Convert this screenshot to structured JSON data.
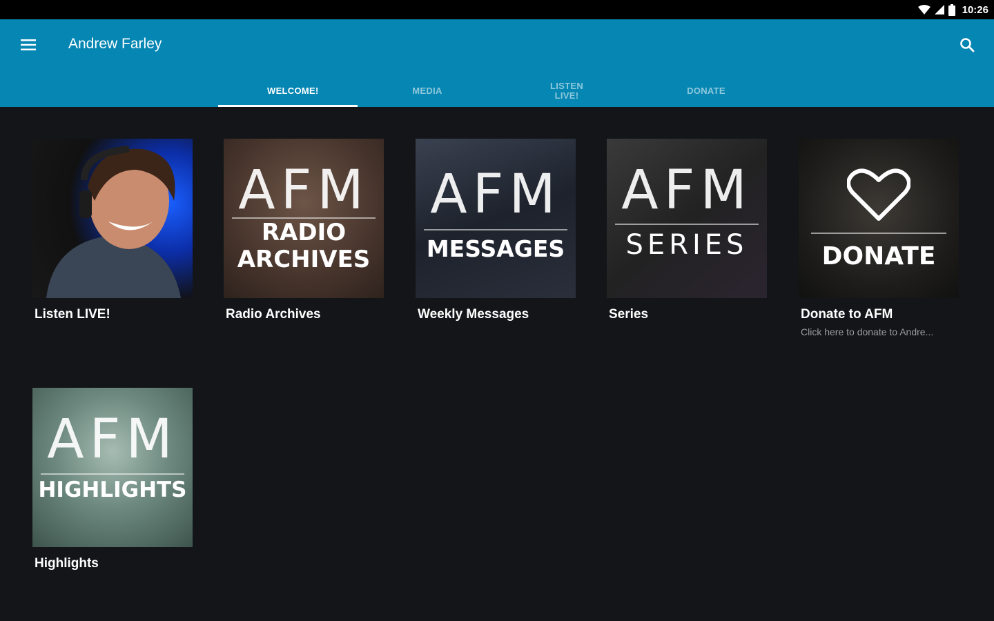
{
  "status_bar": {
    "time": "10:26"
  },
  "app_bar": {
    "title": "Andrew Farley"
  },
  "tabs": [
    {
      "label": "WELCOME!",
      "active": true
    },
    {
      "label": "MEDIA",
      "active": false
    },
    {
      "label": "LISTEN\nLIVE!",
      "active": false
    },
    {
      "label": "DONATE",
      "active": false
    }
  ],
  "tiles": [
    {
      "title": "Listen LIVE!",
      "art": {
        "text": ""
      }
    },
    {
      "title": "Radio Archives",
      "art": {
        "brand": "AFM",
        "line1": "RADIO",
        "line2": "ARCHIVES"
      }
    },
    {
      "title": "Weekly Messages",
      "art": {
        "brand": "AFM",
        "line1": "MESSAGES"
      }
    },
    {
      "title": "Series",
      "art": {
        "brand": "AFM",
        "line1": "SERIES"
      }
    },
    {
      "title": "Donate to AFM",
      "subtitle": "Click here to donate to Andre...",
      "art": {
        "line1": "DONATE"
      }
    },
    {
      "title": "Highlights",
      "art": {
        "brand": "AFM",
        "line1": "HIGHLIGHTS"
      }
    }
  ],
  "colors": {
    "app_bar": "#0586b3",
    "background": "#131518",
    "status_bar": "#000000"
  },
  "icons": {
    "menu": "hamburger-menu-icon",
    "search": "search-icon",
    "wifi": "wifi-icon",
    "signal": "signal-icon",
    "battery": "battery-icon",
    "heart": "heart-icon"
  }
}
